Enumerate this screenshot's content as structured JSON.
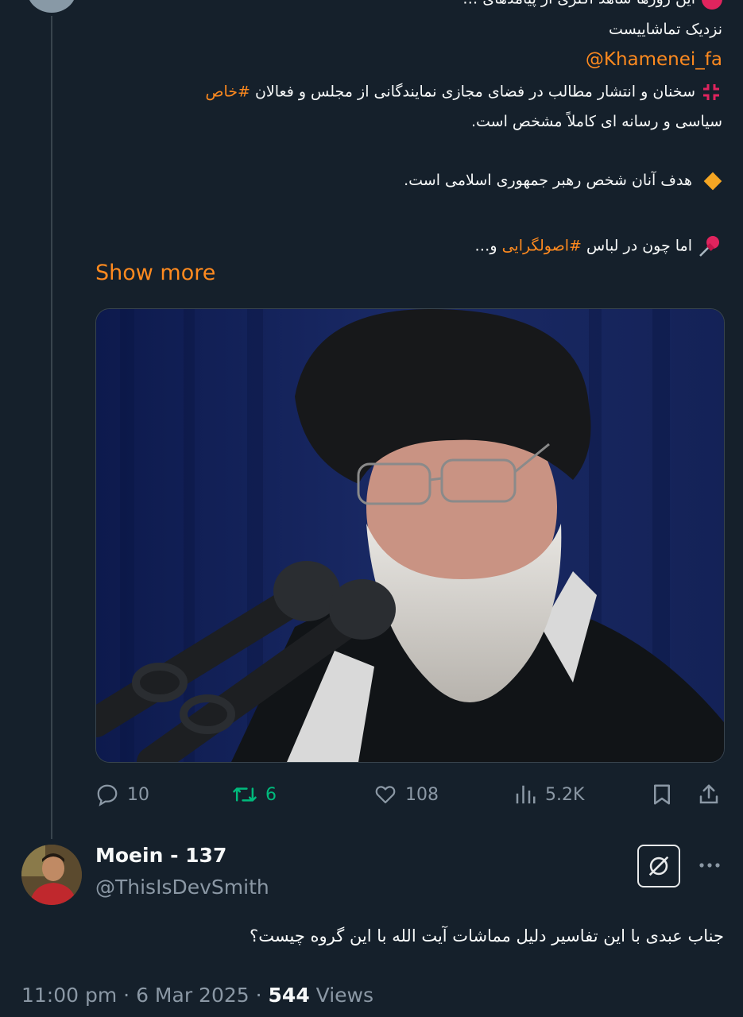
{
  "tweet": {
    "cut_line": "این روزها شاهد اکثری از پیامدهای …",
    "line_2": "نزدیک تماشاییست",
    "mention": "@Khamenei_fa",
    "para_1_line_1_text": "سخنان و انتشار مطالب در فضای مجازی نمایندگانی از مجلس و فعالان",
    "para_1_hashtag": "#خاص",
    "para_1_line_2": "سیاسی و رسانه ای کاملاً مشخص است.",
    "para_2": "هدف آنان شخص رهبر جمهوری اسلامی است.",
    "para_3_prefix": "اما چون در لباس",
    "para_3_hashtag": "#اصولگرایی",
    "para_3_suffix": "و…",
    "show_more": "Show more",
    "actions": {
      "replies": "10",
      "retweets": "6",
      "likes": "108",
      "views": "5.2K"
    }
  },
  "reply": {
    "name": "Moein - 137",
    "handle": "@ThisIsDevSmith",
    "text": "جناب عبدی با این تفاسیر دلیل مماشات آیت الله با این گروه چیست؟",
    "time": "11:00 pm",
    "date": "6 Mar 2025",
    "views_count": "544",
    "views_label": "Views"
  },
  "icons": {
    "reply": "comment-icon",
    "retweet": "retweet-icon",
    "like": "heart-icon",
    "views": "bar-chart-icon",
    "bookmark": "bookmark-icon",
    "share": "share-icon",
    "grok": "grok-icon",
    "more": "more-dots-icon"
  },
  "colors": {
    "background": "#15202b",
    "accent": "#ff8a1f",
    "retweet_active": "#00ba7c",
    "muted": "#8b98a5"
  }
}
